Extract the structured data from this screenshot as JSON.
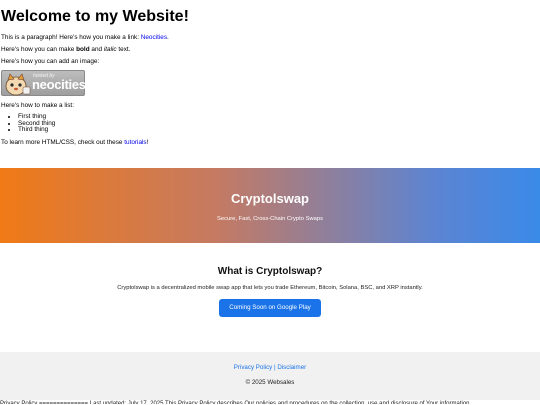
{
  "top": {
    "title": "Welcome to my Website!",
    "para1_text": "This is a paragraph! Here's how you make a link: ",
    "para1_link": "Neocities",
    "para1_end": ".",
    "para2_start": "Here's how you can make ",
    "para2_bold": "bold",
    "para2_mid": " and ",
    "para2_italic": "italic",
    "para2_end": " text.",
    "para3": "Here's how you can add an image:",
    "badge_hosted": "hosted by",
    "badge_brand": "neocities",
    "para4": "Here's how to make a list:",
    "list": [
      "First thing",
      "Second thing",
      "Third thing"
    ],
    "para5_text": "To learn more HTML/CSS, check out these ",
    "para5_link": "tutorials",
    "para5_end": "!"
  },
  "hero": {
    "title": "Cryptolswap",
    "subtitle": "Secure, Fast, Cross-Chain Crypto Swaps"
  },
  "what": {
    "heading": "What is Cryptolswap?",
    "description": "Cryptolswap is a decentralized mobile swap app that lets you trade Ethereum, Bitcoin, Solana, BSC, and XRP instantly.",
    "button": "Coming Soon on Google Play"
  },
  "footer": {
    "privacy_link": "Privacy Policy",
    "separator": " | ",
    "disclaimer_link": "Disclaimer",
    "copyright": "© 2025 Websales"
  },
  "policy_text": "Privacy Policy ============== Last updated: July 17, 2025 This Privacy Policy describes Our policies and procedures on the collection, use and disclosure of Your information"
}
